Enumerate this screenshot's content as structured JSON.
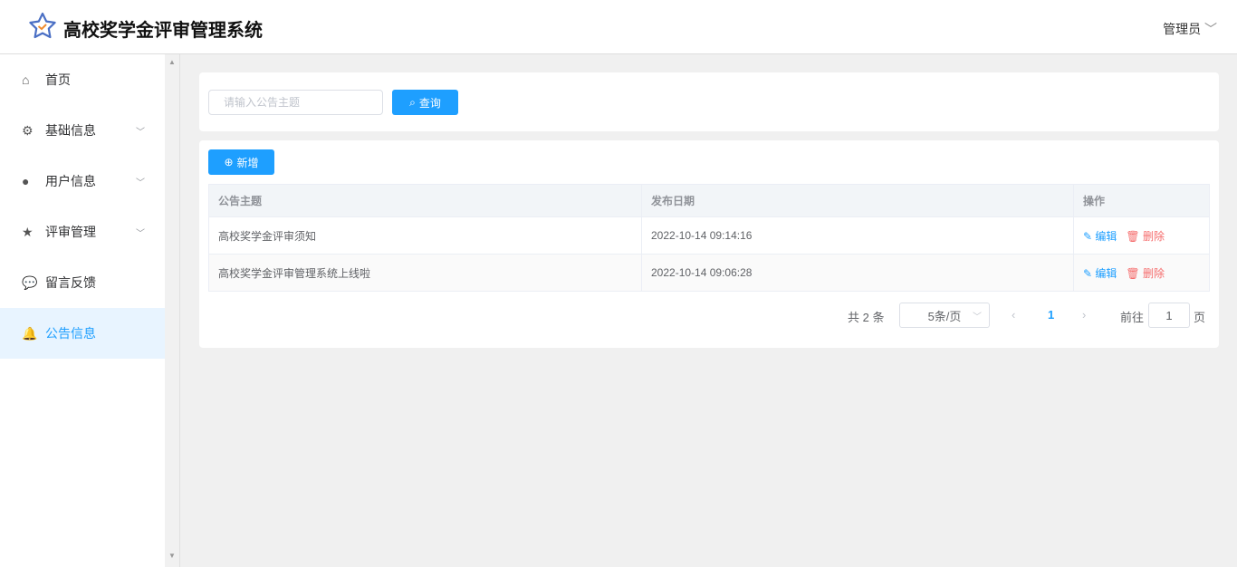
{
  "app": {
    "title": "高校奖学金评审管理系统",
    "user": "管理员"
  },
  "sidebar": {
    "items": [
      {
        "label": "首页",
        "icon": "home-icon"
      },
      {
        "label": "基础信息",
        "icon": "gear-icon"
      },
      {
        "label": "用户信息",
        "icon": "user-icon"
      },
      {
        "label": "评审管理",
        "icon": "star-icon"
      },
      {
        "label": "留言反馈",
        "icon": "comments-icon"
      },
      {
        "label": "公告信息",
        "icon": "bell-icon"
      }
    ]
  },
  "search": {
    "placeholder": "请输入公告主题",
    "button": "查询"
  },
  "toolbar": {
    "add": "新增"
  },
  "table": {
    "headers": [
      "公告主题",
      "发布日期",
      "操作"
    ],
    "rows": [
      {
        "title": "高校奖学金评审须知",
        "date": "2022-10-14 09:14:16"
      },
      {
        "title": "高校奖学金评审管理系统上线啦",
        "date": "2022-10-14 09:06:28"
      }
    ],
    "edit": "编辑",
    "delete": "删除"
  },
  "pagination": {
    "total": "共 2 条",
    "size": "5条/页",
    "current": "1",
    "goto": "前往",
    "goto_value": "1",
    "page_suffix": "页"
  }
}
